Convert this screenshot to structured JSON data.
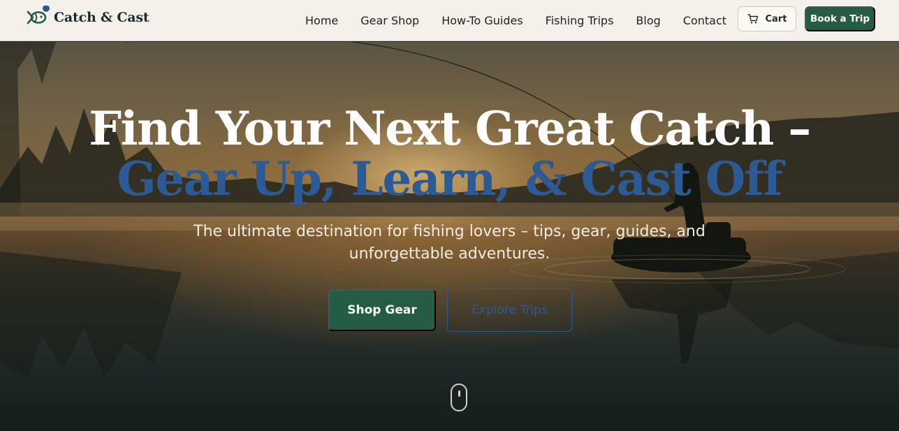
{
  "brand": {
    "name": "Catch & Cast",
    "logo_icon": "fish-logo-icon",
    "accent_color": "#245c45",
    "secondary_color": "#2c5a94"
  },
  "nav": {
    "links": [
      "Home",
      "Gear Shop",
      "How-To Guides",
      "Fishing Trips",
      "Blog",
      "Contact"
    ],
    "cart_label": "Cart",
    "cart_icon": "cart-icon",
    "cta_label": "Book a Trip"
  },
  "hero": {
    "headline_line1": "Find Your Next Great Catch –",
    "headline_line2": "Gear Up, Learn, & Cast Off",
    "subtext_line1": "The ultimate destination for fishing lovers – tips, gear, guides, and",
    "subtext_line2": "unforgettable adventures.",
    "primary_button": "Shop Gear",
    "secondary_button": "Explore Trips",
    "scroll_icon": "mouse-scroll-icon"
  }
}
